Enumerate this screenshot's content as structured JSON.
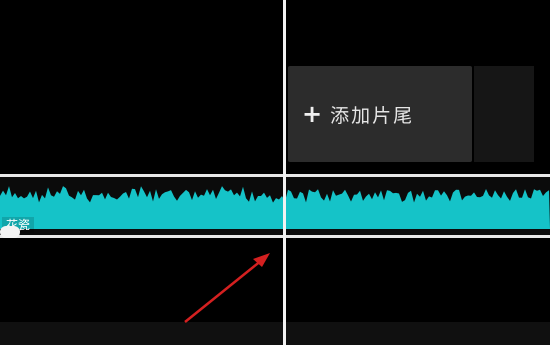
{
  "timeline": {
    "add_ending": {
      "icon": "plus-icon",
      "label": "添加片尾"
    },
    "audio_clip": {
      "label": "花瓷",
      "color": "#15c3c8"
    },
    "colors": {
      "background": "#000000",
      "playhead": "#f2f2f2",
      "track_border": "#e8e8e8",
      "annotation": "#d42020"
    }
  }
}
